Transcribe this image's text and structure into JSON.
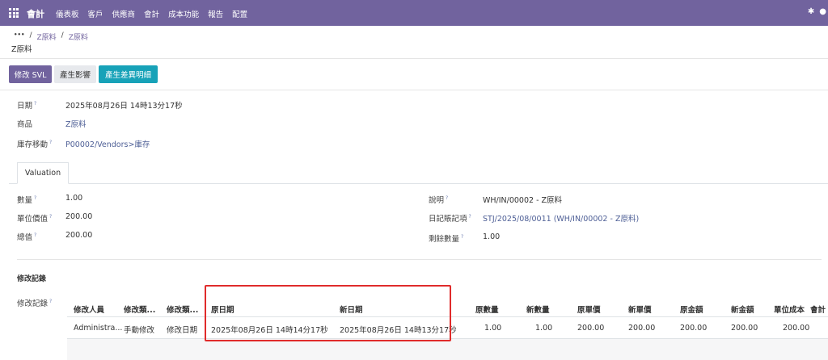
{
  "navbar": {
    "app_name": "會計",
    "menu": [
      "儀表板",
      "客戶",
      "供應商",
      "會計",
      "成本功能",
      "報告",
      "配置"
    ],
    "right_icons": [
      "bug-icon",
      "chat-icon"
    ]
  },
  "breadcrumb": {
    "ellipsis": "•••",
    "items": [
      "Z原料",
      "Z原料"
    ],
    "separator": "/"
  },
  "page_title": "Z原料",
  "buttons": {
    "modify_svl": "修改 SVL",
    "generate_impact": "產生影響",
    "generate_diff": "產生差異明細"
  },
  "fields": {
    "date_label": "日期",
    "date_value": "2025年08月26日 14時13分17秒",
    "product_label": "商品",
    "product_value": "Z原料",
    "stock_move_label": "庫存移動",
    "stock_move_value": "P00002/Vendors>庫存"
  },
  "tabs": {
    "valuation": "Valuation"
  },
  "valuation": {
    "qty_label": "數量",
    "qty_value": "1.00",
    "unit_value_label": "單位價值",
    "unit_value_value": "200.00",
    "total_label": "總值",
    "total_value": "200.00",
    "desc_label": "說明",
    "desc_value": "WH/IN/00002 - Z原料",
    "journal_label": "日記賬記項",
    "journal_value": "STJ/2025/08/0011 (WH/IN/00002 - Z原料)",
    "remaining_label": "剩餘數量",
    "remaining_value": "1.00"
  },
  "history": {
    "section_title": "修改記錄",
    "field_label": "修改記錄",
    "headers": [
      "修改人員",
      "修改類...",
      "修改類...",
      "原日期",
      "新日期",
      "原數量",
      "新數量",
      "原單價",
      "新單價",
      "原金額",
      "新金額",
      "單位成本",
      "會計"
    ],
    "row": [
      "Administra...",
      "手動修改",
      "修改日期",
      "2025年08月26日 14時14分17秒",
      "2025年08月26日 14時13分17秒",
      "1.00",
      "1.00",
      "200.00",
      "200.00",
      "200.00",
      "200.00",
      "200.00",
      ""
    ]
  },
  "colors": {
    "navbar": "#71639e",
    "primary": "#71639e",
    "info": "#17a2b8",
    "highlight": "#e02b2b"
  }
}
